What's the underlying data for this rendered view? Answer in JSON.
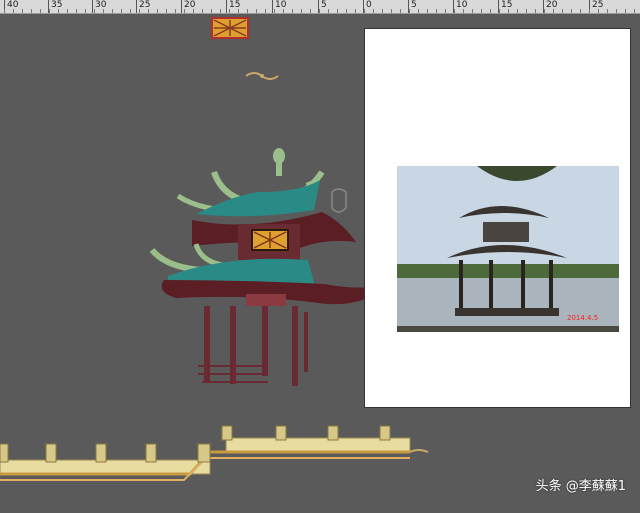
{
  "ruler": {
    "labels": [
      "40",
      "35",
      "30",
      "25",
      "20",
      "15",
      "10",
      "5",
      "0",
      "5",
      "10",
      "15",
      "20",
      "25"
    ]
  },
  "artboard": {
    "photo": {
      "photo_text": "2014.4.5"
    }
  },
  "watermark": {
    "brand": "头条",
    "handle": "@李蘇蘇1"
  },
  "colors": {
    "workspace": "#5a5a5a",
    "ruler": "#d9d9d9",
    "roof_teal": "#2a8a86",
    "roof_maroon": "#5a1e24",
    "pillar": "#6a2a32",
    "eave_green": "#9bbf8a",
    "lattice_gold": "#e0a030",
    "railing_cream": "#e8dca0"
  }
}
